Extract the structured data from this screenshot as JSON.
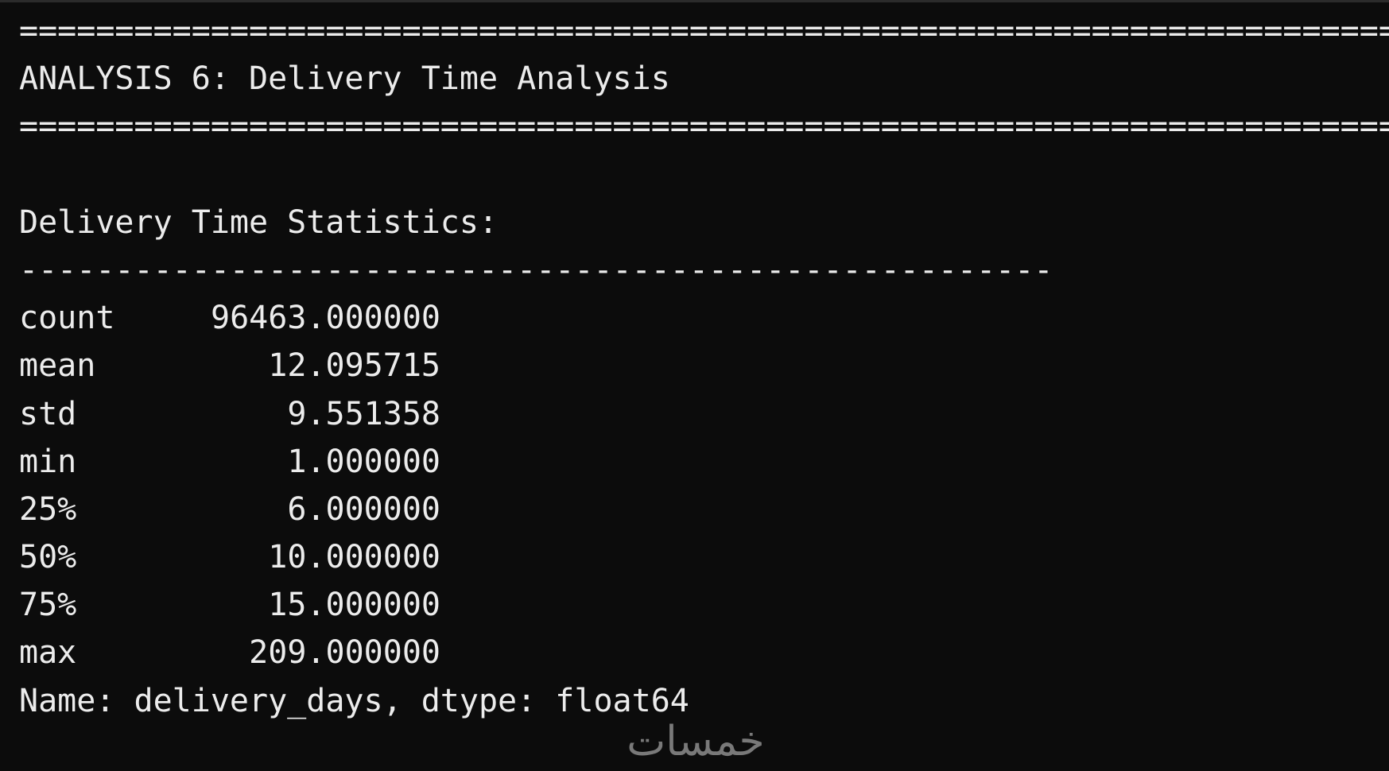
{
  "terminal": {
    "rule_top": "===========================================================================",
    "analysis_title": "ANALYSIS 6: Delivery Time Analysis",
    "rule_bottom": "===========================================================================",
    "stats_heading": "Delivery Time Statistics:",
    "dash_rule": "------------------------------------------------------",
    "stats": [
      {
        "key": "count",
        "value": "96463.000000"
      },
      {
        "key": "mean",
        "value": "12.095715"
      },
      {
        "key": "std",
        "value": "9.551358"
      },
      {
        "key": "min",
        "value": "1.000000"
      },
      {
        "key": "25%",
        "value": "6.000000"
      },
      {
        "key": "50%",
        "value": "10.000000"
      },
      {
        "key": "75%",
        "value": "15.000000"
      },
      {
        "key": "max",
        "value": "209.000000"
      }
    ],
    "series_footer": "Name: delivery_days, dtype: float64"
  },
  "watermark": {
    "text": "خمسات"
  },
  "colors": {
    "background": "#0c0c0c",
    "text": "#ececec",
    "watermark": "#8d8d8d"
  }
}
